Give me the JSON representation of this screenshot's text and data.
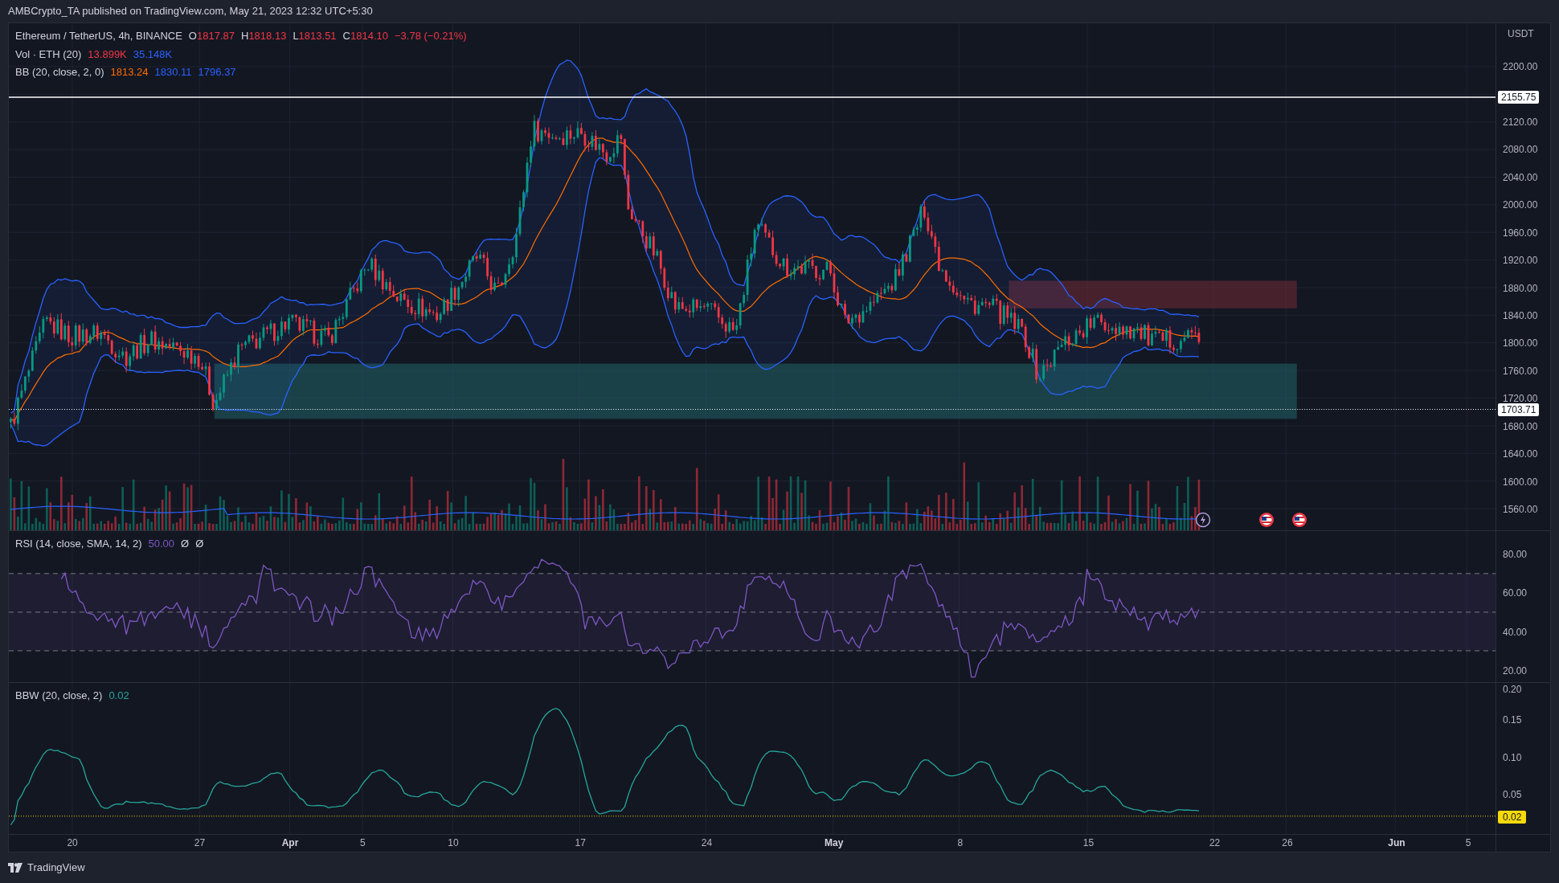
{
  "publish_line": "AMBCrypto_TA published on TradingView.com, May 21, 2023 12:32 UTC+5:30",
  "legend": {
    "symbol": "Ethereum / TetherUS, 4h, BINANCE",
    "ohlc": [
      {
        "label": "O",
        "value": "1817.87"
      },
      {
        "label": "H",
        "value": "1818.13"
      },
      {
        "label": "L",
        "value": "1813.51"
      },
      {
        "label": "C",
        "value": "1814.10"
      }
    ],
    "change": "−3.78 (−0.21%)"
  },
  "volume": {
    "label": "Vol · ETH (20)",
    "values": [
      {
        "text": "13.899K",
        "color": "#f23645"
      },
      {
        "text": "35.148K",
        "color": "#2962ff"
      }
    ]
  },
  "bb": {
    "label": "BB (20, close, 2, 0)",
    "values": [
      {
        "text": "1813.24",
        "color": "#ff6d00"
      },
      {
        "text": "1830.11",
        "color": "#2962ff"
      },
      {
        "text": "1796.37",
        "color": "#2962ff"
      }
    ]
  },
  "price_axis": {
    "unit": "USDT",
    "ticks": [
      "2200.00",
      "2120.00",
      "2080.00",
      "2040.00",
      "2000.00",
      "1960.00",
      "1920.00",
      "1880.00",
      "1840.00",
      "1800.00",
      "1760.00",
      "1720.00",
      "1680.00",
      "1640.00",
      "1600.00",
      "1560.00"
    ],
    "markers": [
      {
        "text": "2155.75",
        "kind": "solid"
      },
      {
        "text": "1703.71",
        "kind": "dotted"
      }
    ]
  },
  "events": [
    {
      "kind": "split"
    },
    {
      "kind": "flag"
    },
    {
      "kind": "flag"
    }
  ],
  "rsi": {
    "label": "RSI (14, close, SMA, 14, 2)",
    "value": "50.00",
    "extras": [
      "Ø",
      "Ø"
    ],
    "ticks": [
      "80.00",
      "60.00",
      "40.00",
      "20.00"
    ]
  },
  "bbw": {
    "label": "BBW (20, close, 2)",
    "value": "0.02",
    "ticks": [
      "0.20",
      "0.15",
      "0.10",
      "0.05"
    ],
    "marker": "0.02"
  },
  "time_axis": [
    {
      "text": "20",
      "kind": "day"
    },
    {
      "text": "27",
      "kind": "day"
    },
    {
      "text": "Apr",
      "kind": "month"
    },
    {
      "text": "5",
      "kind": "day"
    },
    {
      "text": "10",
      "kind": "day"
    },
    {
      "text": "17",
      "kind": "day"
    },
    {
      "text": "24",
      "kind": "day"
    },
    {
      "text": "May",
      "kind": "month"
    },
    {
      "text": "8",
      "kind": "day"
    },
    {
      "text": "15",
      "kind": "day"
    },
    {
      "text": "22",
      "kind": "day"
    },
    {
      "text": "26",
      "kind": "day"
    },
    {
      "text": "Jun",
      "kind": "month"
    },
    {
      "text": "5",
      "kind": "day"
    }
  ],
  "footer": {
    "brand": "TradingView"
  }
}
